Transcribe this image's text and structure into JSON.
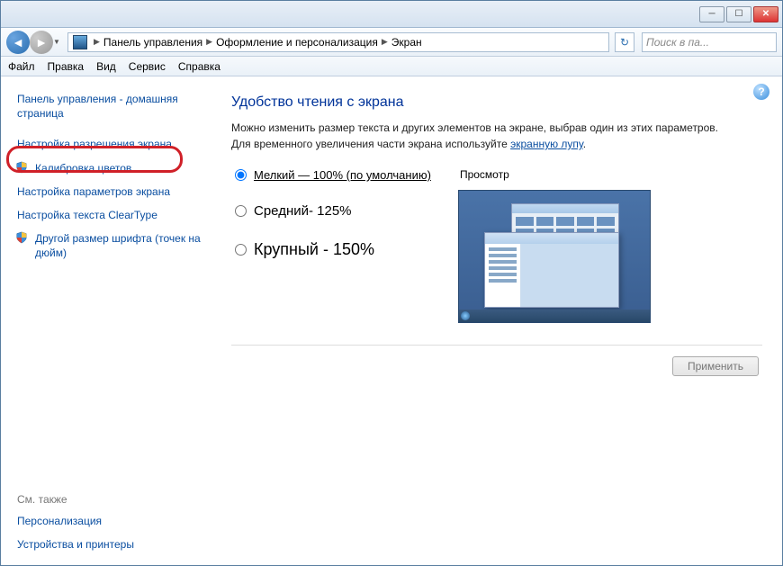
{
  "breadcrumb": {
    "root": "Панель управления",
    "mid": "Оформление и персонализация",
    "leaf": "Экран"
  },
  "search": {
    "placeholder": "Поиск в па..."
  },
  "menu": {
    "file": "Файл",
    "edit": "Правка",
    "view": "Вид",
    "tools": "Сервис",
    "help": "Справка"
  },
  "sidebar": {
    "home": "Панель управления - домашняя страница",
    "items": [
      "Настройка разрешения экрана",
      "Калибровка цветов",
      "Настройка параметров экрана",
      "Настройка текста ClearType",
      "Другой размер шрифта (точек на дюйм)"
    ],
    "see_also_h": "См. также",
    "see_also": [
      "Персонализация",
      "Устройства и принтеры"
    ]
  },
  "content": {
    "heading": "Удобство чтения с экрана",
    "desc_part1": "Можно изменить размер текста и других элементов на экране, выбрав один из этих параметров. Для временного увеличения части экрана используйте ",
    "desc_link": "экранную лупу",
    "desc_part2": ".",
    "radios": {
      "small": "Мелкий — 100% (по умолчанию)",
      "medium": "Средний- 125%",
      "large": "Крупный - 150%"
    },
    "preview_h": "Просмотр",
    "apply": "Применить"
  }
}
